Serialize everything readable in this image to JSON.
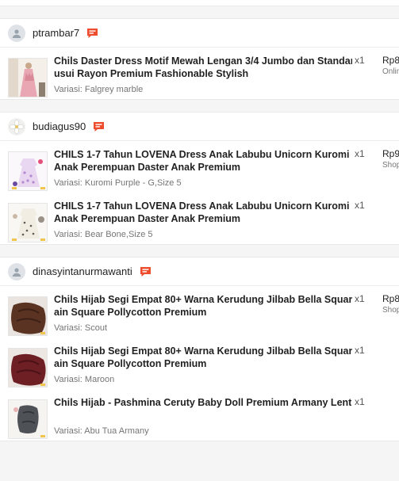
{
  "orders": [
    {
      "user": "ptrambar7",
      "items": [
        {
          "title1": "Chils Daster Dress Motif Mewah Lengan 3/4 Jumbo dan Standar B",
          "title2": "usui Rayon Premium Fashionable Stylish",
          "variant": "Variasi: Falgrey marble",
          "qty": "x1",
          "price": "Rp8",
          "status": "Onlin"
        }
      ]
    },
    {
      "user": "budiagus90",
      "items": [
        {
          "title1": "CHILS 1-7 Tahun LOVENA Dress Anak Labubu Unicorn Kuromi Baju",
          "title2": "Anak Perempuan Daster Anak Premium",
          "variant": "Variasi: Kuromi Purple - G,Size 5",
          "qty": "x1",
          "price": "Rp9",
          "status": "Shop"
        },
        {
          "title1": "CHILS 1-7 Tahun LOVENA Dress Anak Labubu Unicorn Kuromi Baju",
          "title2": "Anak Perempuan Daster Anak Premium",
          "variant": "Variasi: Bear Bone,Size 5",
          "qty": "x1",
          "price": "",
          "status": ""
        }
      ]
    },
    {
      "user": "dinasyintanurmawanti",
      "items": [
        {
          "title1": "Chils Hijab Segi Empat 80+ Warna Kerudung Jilbab Bella Square Pl",
          "title2": "ain Square Pollycotton Premium",
          "variant": "Variasi: Scout",
          "qty": "x1",
          "price": "Rp8",
          "status": "Shop"
        },
        {
          "title1": "Chils Hijab Segi Empat 80+ Warna Kerudung Jilbab Bella Square Pl",
          "title2": "ain Square Pollycotton Premium",
          "variant": "Variasi: Maroon",
          "qty": "x1",
          "price": "",
          "status": ""
        },
        {
          "title1": "Chils Hijab - Pashmina Ceruty Baby Doll Premium Armany Lentur",
          "title2": "",
          "variant": "Variasi: Abu Tua Armany",
          "qty": "x1",
          "price": "",
          "status": ""
        }
      ]
    }
  ],
  "icons": {
    "chat": "chat-bubble-icon",
    "user": "user-silhouette-icon"
  },
  "colors": {
    "chat_icon": "#ee4d2d",
    "avatar_bg": "#dfe3e8"
  }
}
